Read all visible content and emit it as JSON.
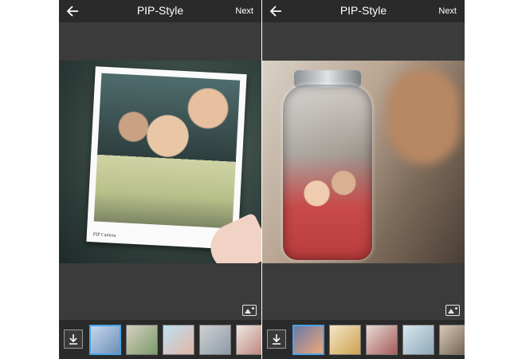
{
  "screens": [
    {
      "id": "left",
      "title": "PIP-Style",
      "next_label": "Next",
      "photo_caption": "PIP Camera",
      "thumbnails": [
        {
          "name": "frame-polaroid",
          "selected": true,
          "colors": [
            "#c6d7ee",
            "#6c8fb6"
          ]
        },
        {
          "name": "frame-circle-flowers",
          "selected": false,
          "colors": [
            "#d7d0bf",
            "#7b9a6b"
          ]
        },
        {
          "name": "frame-heart-beach",
          "selected": false,
          "colors": [
            "#bfe0f2",
            "#e0b6a6"
          ]
        },
        {
          "name": "frame-square-couple",
          "selected": false,
          "colors": [
            "#d1d1d1",
            "#8b9aa8"
          ]
        },
        {
          "name": "frame-white-border",
          "selected": false,
          "colors": [
            "#efe8e3",
            "#b97c73"
          ]
        }
      ]
    },
    {
      "id": "right",
      "title": "PIP-Style",
      "next_label": "Next",
      "thumbnails": [
        {
          "name": "frame-bottle",
          "selected": true,
          "colors": [
            "#6a7aa8",
            "#f0a77a"
          ]
        },
        {
          "name": "frame-glass-drink",
          "selected": false,
          "colors": [
            "#f3e6c8",
            "#cfa24f"
          ]
        },
        {
          "name": "frame-heart-locket",
          "selected": false,
          "colors": [
            "#e8dcd4",
            "#a65a5a"
          ]
        },
        {
          "name": "frame-light-bulb",
          "selected": false,
          "colors": [
            "#d9e7ef",
            "#8ea8b8"
          ]
        },
        {
          "name": "frame-film-strip",
          "selected": false,
          "colors": [
            "#d8c9b8",
            "#6a5a4a"
          ]
        }
      ]
    }
  ]
}
